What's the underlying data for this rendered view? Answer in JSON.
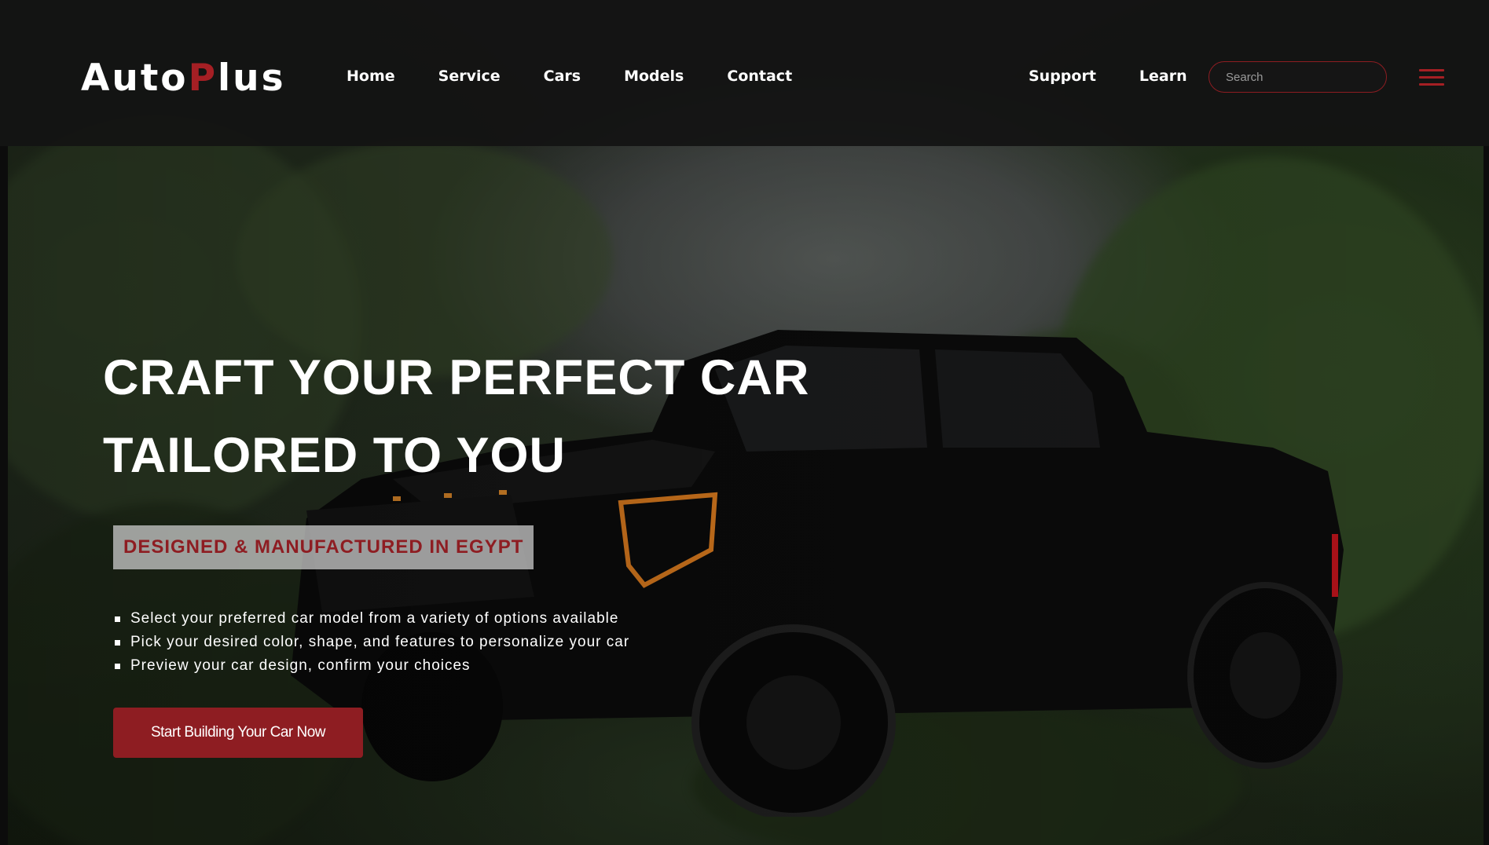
{
  "brand": {
    "logo_part1": "Auto",
    "logo_accent": "P",
    "logo_part2": "lus"
  },
  "nav": {
    "left": [
      "Home",
      "Service",
      "Cars",
      "Models",
      "Contact"
    ],
    "right": [
      "Support",
      "Learn"
    ]
  },
  "search": {
    "placeholder": "Search"
  },
  "menu": {
    "icon": "hamburger-menu-icon"
  },
  "hero": {
    "headline_line1": "CRAFT YOUR PERFECT CAR",
    "headline_line2": "TAILORED TO YOU",
    "tagline": "DESIGNED & MANUFACTURED IN EGYPT",
    "bullets": [
      "Select your preferred car model from a variety of options available",
      "Pick your desired color, shape, and features to personalize your car",
      "Preview your car design, confirm your choices"
    ],
    "cta_label": "Start Building Your Car Now"
  },
  "colors": {
    "accent": "#a51f24",
    "button": "#8e1d22",
    "header_bg": "#121212",
    "text": "#ffffff"
  }
}
